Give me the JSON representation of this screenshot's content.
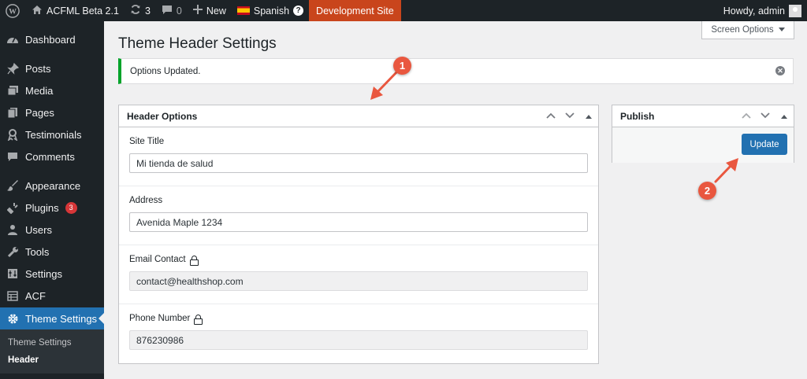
{
  "adminbar": {
    "site_name": "ACFML Beta 2.1",
    "updates_count": "3",
    "comments_count": "0",
    "new_label": "New",
    "language": "Spanish",
    "help": "?",
    "dev_site": "Development Site",
    "howdy": "Howdy, admin",
    "dev_site_color": "#c9451c"
  },
  "sidebar": {
    "items": [
      {
        "label": "Dashboard",
        "icon": "dashboard-icon"
      },
      {
        "label": "Posts",
        "icon": "pin-icon"
      },
      {
        "label": "Media",
        "icon": "media-icon"
      },
      {
        "label": "Pages",
        "icon": "pages-icon"
      },
      {
        "label": "Testimonials",
        "icon": "testimonials-icon"
      },
      {
        "label": "Comments",
        "icon": "comment-icon"
      },
      {
        "label": "Appearance",
        "icon": "brush-icon"
      },
      {
        "label": "Plugins",
        "icon": "plugin-icon",
        "badge": "3"
      },
      {
        "label": "Users",
        "icon": "user-icon"
      },
      {
        "label": "Tools",
        "icon": "wrench-icon"
      },
      {
        "label": "Settings",
        "icon": "settings-icon"
      },
      {
        "label": "ACF",
        "icon": "acf-icon"
      },
      {
        "label": "Theme Settings",
        "icon": "gear-icon"
      }
    ],
    "submenu": [
      "Theme Settings",
      "Header"
    ]
  },
  "screen_options": "Screen Options",
  "page_title": "Theme Header Settings",
  "notice": "Options Updated.",
  "header_box": {
    "title": "Header Options",
    "fields": [
      {
        "label": "Site Title",
        "value": "Mi tienda de salud",
        "locked": false
      },
      {
        "label": "Address",
        "value": "Avenida Maple 1234",
        "locked": false
      },
      {
        "label": "Email Contact",
        "value": "contact@healthshop.com",
        "locked": true
      },
      {
        "label": "Phone Number",
        "value": "876230986",
        "locked": true
      }
    ]
  },
  "publish_box": {
    "title": "Publish",
    "update_label": "Update"
  },
  "callouts": [
    "1",
    "2"
  ],
  "colors": {
    "accent": "#2271b1",
    "notice_success": "#00a32a",
    "callout": "#e9573f"
  }
}
